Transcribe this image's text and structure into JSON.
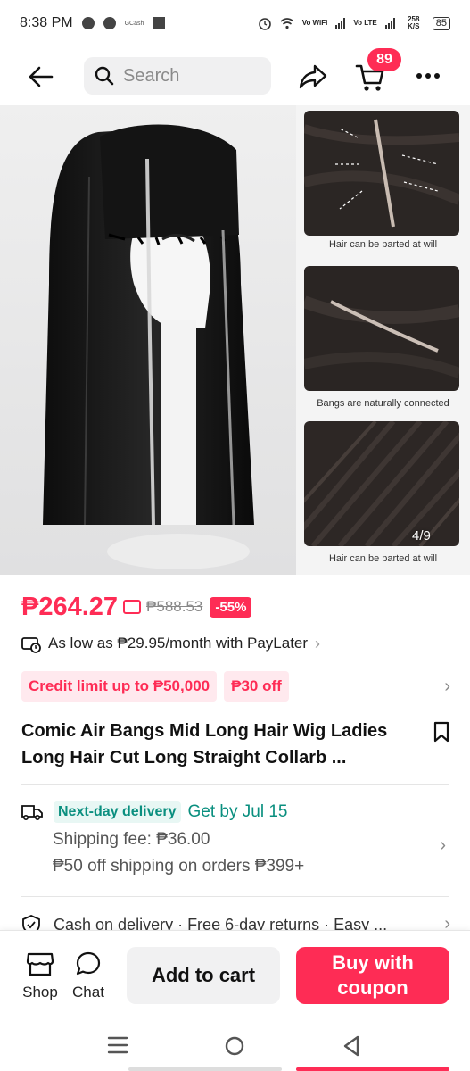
{
  "status_bar": {
    "time": "8:38 PM",
    "gcash_label": "GCash",
    "network_1": "Vo WiFi",
    "network_2": "Vo LTE",
    "speed": "258 K/S",
    "battery": "85"
  },
  "header": {
    "search_placeholder": "Search",
    "cart_count": "89"
  },
  "gallery": {
    "thumb_captions": [
      "Hair can be parted at will",
      "Bangs are naturally connected",
      "Hair can be parted at will"
    ],
    "counter": "4/9"
  },
  "product": {
    "price": "₱264.27",
    "original_price": "₱588.53",
    "discount": "-55%",
    "paylater_text": "As low as ₱29.95/month with PayLater",
    "chips": [
      "Credit limit up to ₱50,000",
      "₱30 off"
    ],
    "title": "Comic Air Bangs Mid Long Hair Wig Ladies Long Hair Cut Long Straight Collarb ..."
  },
  "delivery": {
    "badge": "Next-day delivery",
    "get_by": "Get by Jul 15",
    "shipping_fee": "Shipping fee: ₱36.00",
    "shipping_discount": "₱50 off shipping on orders ₱399+"
  },
  "services": {
    "text": "Cash on delivery · Free 6-day returns · Easy ..."
  },
  "bottom_bar": {
    "shop_label": "Shop",
    "chat_label": "Chat",
    "add_to_cart": "Add to cart",
    "buy_with_coupon": "Buy with coupon"
  },
  "colors": {
    "accent": "#fe2c55",
    "delivery_green": "#0a8f7f"
  }
}
